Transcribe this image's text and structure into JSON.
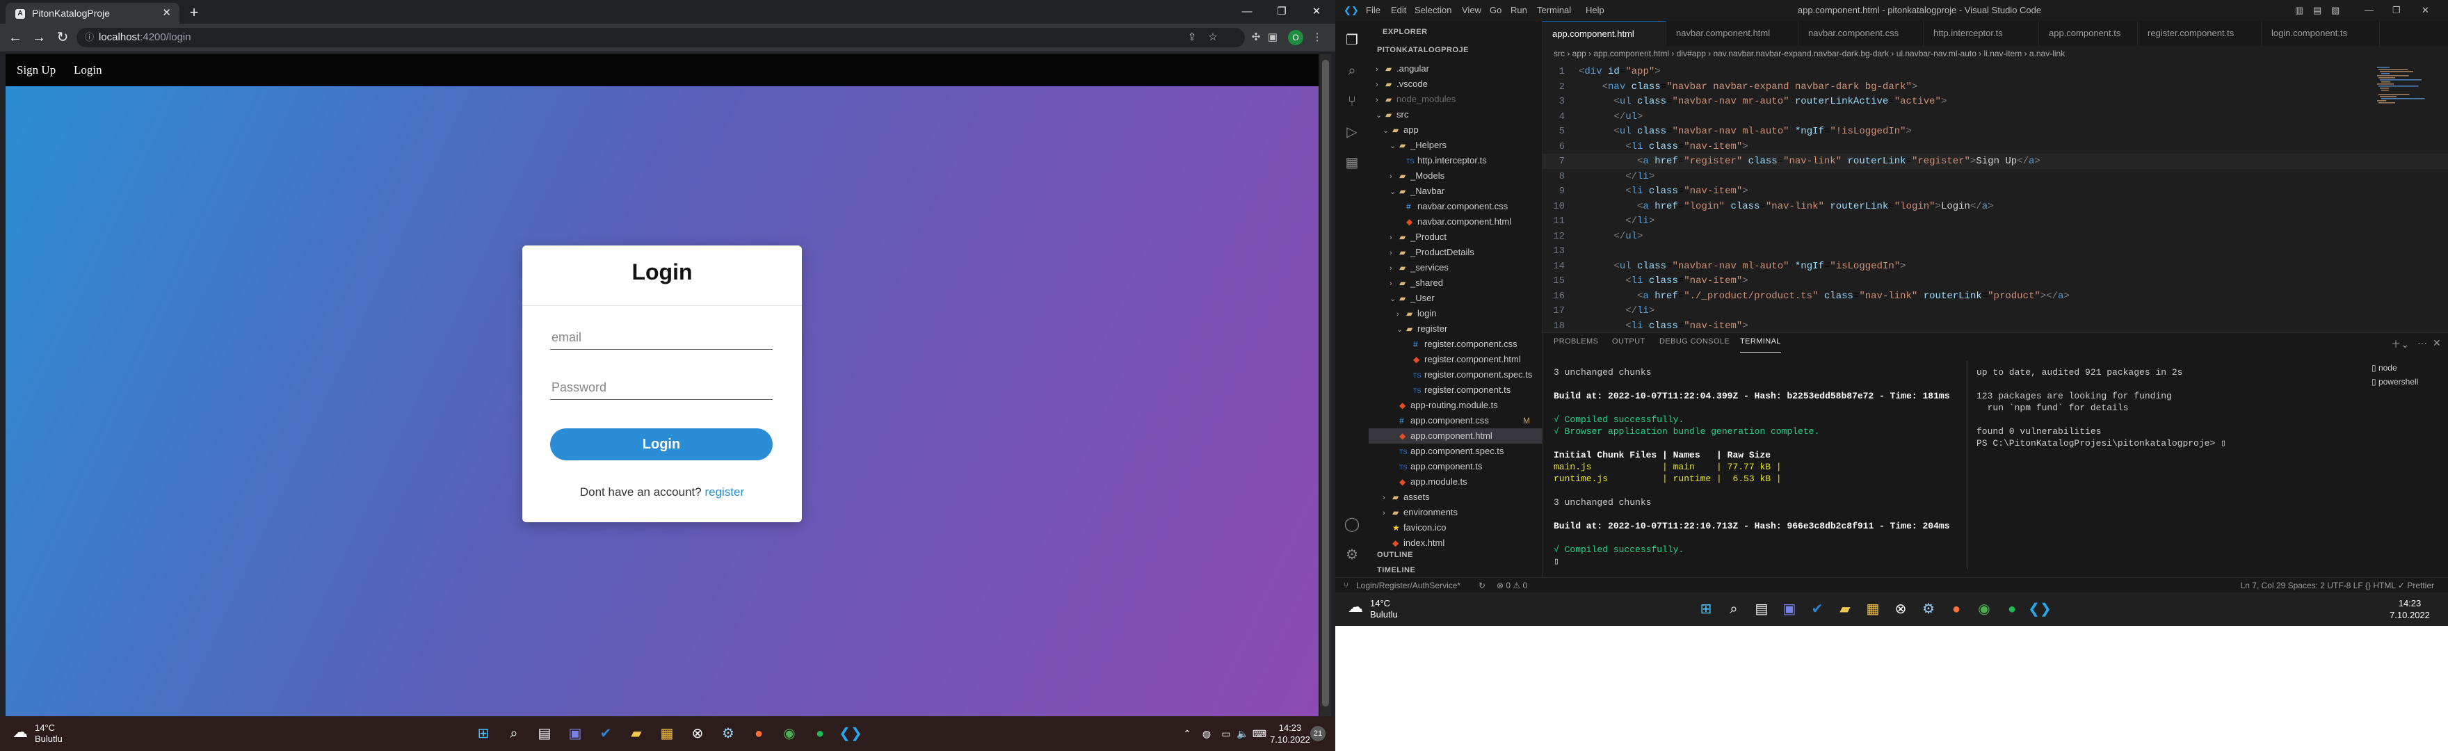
{
  "browser": {
    "tab_title": "PitonKatalogProje",
    "tab_favicon": "A",
    "url_host": "localhost",
    "url_path": ":4200/login",
    "profile_initial": "O"
  },
  "site": {
    "nav_signup": "Sign Up",
    "nav_login": "Login",
    "card": {
      "title": "Login",
      "email_placeholder": "email",
      "password_placeholder": "Password",
      "login_button": "Login",
      "no_account_text": "Dont have an account?",
      "register_link": "register"
    }
  },
  "taskbar_left": {
    "weather_temp": "14°C",
    "weather_desc": "Bulutlu",
    "time": "14:23",
    "date": "7.10.2022",
    "notification_count": "21"
  },
  "vscode": {
    "title": "app.component.html - pitonkatalogproje - Visual Studio Code",
    "menu": [
      "File",
      "Edit",
      "Selection",
      "View",
      "Go",
      "Run",
      "Terminal",
      "Help"
    ],
    "explorer_label": "EXPLORER",
    "project_label": "PITONKATALOGPROJE",
    "tree": [
      {
        "label": ".angular",
        "depth": 1,
        "kind": "folder",
        "chev": "›"
      },
      {
        "label": ".vscode",
        "depth": 1,
        "kind": "folder",
        "chev": "›"
      },
      {
        "label": "node_modules",
        "depth": 1,
        "kind": "folder",
        "chev": "›"
      },
      {
        "label": "src",
        "depth": 1,
        "kind": "folder",
        "chev": "⌄"
      },
      {
        "label": "app",
        "depth": 2,
        "kind": "folder",
        "chev": "⌄"
      },
      {
        "label": "_Helpers",
        "depth": 3,
        "kind": "folder",
        "chev": "⌄"
      },
      {
        "label": "http.interceptor.ts",
        "depth": 4,
        "kind": "ts",
        "chev": ""
      },
      {
        "label": "_Models",
        "depth": 3,
        "kind": "folder",
        "chev": "›"
      },
      {
        "label": "_Navbar",
        "depth": 3,
        "kind": "folder",
        "chev": "⌄"
      },
      {
        "label": "navbar.component.css",
        "depth": 4,
        "kind": "css",
        "chev": ""
      },
      {
        "label": "navbar.component.html",
        "depth": 4,
        "kind": "html",
        "chev": ""
      },
      {
        "label": "_Product",
        "depth": 3,
        "kind": "folder",
        "chev": "›"
      },
      {
        "label": "_ProductDetails",
        "depth": 3,
        "kind": "folder",
        "chev": "›"
      },
      {
        "label": "_services",
        "depth": 3,
        "kind": "folder",
        "chev": "›"
      },
      {
        "label": "_shared",
        "depth": 3,
        "kind": "folder",
        "chev": "›"
      },
      {
        "label": "_User",
        "depth": 3,
        "kind": "folder",
        "chev": "⌄"
      },
      {
        "label": "login",
        "depth": 4,
        "kind": "folder",
        "chev": "›"
      },
      {
        "label": "register",
        "depth": 4,
        "kind": "folder",
        "chev": "⌄"
      },
      {
        "label": "register.component.css",
        "depth": 5,
        "kind": "css",
        "chev": ""
      },
      {
        "label": "register.component.html",
        "depth": 5,
        "kind": "html",
        "chev": ""
      },
      {
        "label": "register.component.spec.ts",
        "depth": 5,
        "kind": "ts",
        "chev": ""
      },
      {
        "label": "register.component.ts",
        "depth": 5,
        "kind": "ts",
        "chev": ""
      },
      {
        "label": "app-routing.module.ts",
        "depth": 3,
        "kind": "html",
        "chev": ""
      },
      {
        "label": "app.component.css",
        "depth": 3,
        "kind": "css",
        "chev": "",
        "badge": "M"
      },
      {
        "label": "app.component.html",
        "depth": 3,
        "kind": "html",
        "chev": "",
        "selected": true
      },
      {
        "label": "app.component.spec.ts",
        "depth": 3,
        "kind": "ts",
        "chev": ""
      },
      {
        "label": "app.component.ts",
        "depth": 3,
        "kind": "ts",
        "chev": ""
      },
      {
        "label": "app.module.ts",
        "depth": 3,
        "kind": "html",
        "chev": ""
      },
      {
        "label": "assets",
        "depth": 2,
        "kind": "folder",
        "chev": "›"
      },
      {
        "label": "environments",
        "depth": 2,
        "kind": "folder",
        "chev": "›"
      },
      {
        "label": "favicon.ico",
        "depth": 2,
        "kind": "star",
        "chev": ""
      },
      {
        "label": "index.html",
        "depth": 2,
        "kind": "html",
        "chev": ""
      }
    ],
    "outline_label": "OUTLINE",
    "timeline_label": "TIMELINE",
    "tabs": [
      "app.component.html",
      "navbar.component.html",
      "navbar.component.css",
      "http.interceptor.ts",
      "app.component.ts",
      "register.component.ts",
      "login.component.ts"
    ],
    "breadcrumb": "src › app › app.component.html › div#app › nav.navbar.navbar-expand.navbar-dark.bg-dark › ul.navbar-nav.ml-auto › li.nav-item › a.nav-link",
    "code_lines": [
      {
        "n": "1",
        "html": "<span class=\"pn\">&lt;</span><span class=\"tg\">div</span> <span class=\"at\">id</span>=<span class=\"sv\">\"app\"</span><span class=\"pn\">&gt;</span>"
      },
      {
        "n": "2",
        "html": "    <span class=\"pn\">&lt;</span><span class=\"tg\">nav</span> <span class=\"at\">class</span>=<span class=\"sv\">\"navbar navbar-expand navbar-dark bg-dark\"</span><span class=\"pn\">&gt;</span>"
      },
      {
        "n": "3",
        "html": "      <span class=\"pn\">&lt;</span><span class=\"tg\">ul</span> <span class=\"at\">class</span>=<span class=\"sv\">\"navbar-nav mr-auto\"</span> <span class=\"at\">routerLinkActive</span>=<span class=\"sv\">\"active\"</span><span class=\"pn\">&gt;</span>"
      },
      {
        "n": "4",
        "html": "      <span class=\"pn\">&lt;/</span><span class=\"tg\">ul</span><span class=\"pn\">&gt;</span>"
      },
      {
        "n": "5",
        "html": "      <span class=\"pn\">&lt;</span><span class=\"tg\">ul</span> <span class=\"at\">class</span>=<span class=\"sv\">\"navbar-nav ml-auto\"</span> <span class=\"at\">*ngIf</span>=<span class=\"sv\">\"!isLoggedIn\"</span><span class=\"pn\">&gt;</span>"
      },
      {
        "n": "6",
        "html": "        <span class=\"pn\">&lt;</span><span class=\"tg\">li</span> <span class=\"at\">class</span>=<span class=\"sv\">\"nav-item\"</span><span class=\"pn\">&gt;</span>"
      },
      {
        "n": "7",
        "html": "          <span class=\"pn\">&lt;</span><span class=\"tg\">a</span> <span class=\"at\">href</span>=<span class=\"sv\">\"register\"</span> <span class=\"at\">class</span>=<span class=\"sv\">\"nav-link\"</span> <span class=\"at\">routerLink</span>=<span class=\"sv\">\"register\"</span><span class=\"pn\">&gt;</span><span class=\"tx\">Sign Up</span><span class=\"pn\">&lt;/</span><span class=\"tg\">a</span><span class=\"pn\">&gt;</span>",
        "current": true
      },
      {
        "n": "8",
        "html": "        <span class=\"pn\">&lt;/</span><span class=\"tg\">li</span><span class=\"pn\">&gt;</span>"
      },
      {
        "n": "9",
        "html": "        <span class=\"pn\">&lt;</span><span class=\"tg\">li</span> <span class=\"at\">class</span>=<span class=\"sv\">\"nav-item\"</span><span class=\"pn\">&gt;</span>"
      },
      {
        "n": "10",
        "html": "          <span class=\"pn\">&lt;</span><span class=\"tg\">a</span> <span class=\"at\">href</span>=<span class=\"sv\">\"login\"</span> <span class=\"at\">class</span>=<span class=\"sv\">\"nav-link\"</span> <span class=\"at\">routerLink</span>=<span class=\"sv\">\"login\"</span><span class=\"pn\">&gt;</span><span class=\"tx\">Login</span><span class=\"pn\">&lt;/</span><span class=\"tg\">a</span><span class=\"pn\">&gt;</span>"
      },
      {
        "n": "11",
        "html": "        <span class=\"pn\">&lt;/</span><span class=\"tg\">li</span><span class=\"pn\">&gt;</span>"
      },
      {
        "n": "12",
        "html": "      <span class=\"pn\">&lt;/</span><span class=\"tg\">ul</span><span class=\"pn\">&gt;</span>"
      },
      {
        "n": "13",
        "html": ""
      },
      {
        "n": "14",
        "html": "      <span class=\"pn\">&lt;</span><span class=\"tg\">ul</span> <span class=\"at\">class</span>=<span class=\"sv\">\"navbar-nav ml-auto\"</span> <span class=\"at\">*ngIf</span>=<span class=\"sv\">\"isLoggedIn\"</span><span class=\"pn\">&gt;</span>"
      },
      {
        "n": "15",
        "html": "        <span class=\"pn\">&lt;</span><span class=\"tg\">li</span> <span class=\"at\">class</span>=<span class=\"sv\">\"nav-item\"</span><span class=\"pn\">&gt;</span>"
      },
      {
        "n": "16",
        "html": "          <span class=\"pn\">&lt;</span><span class=\"tg\">a</span> <span class=\"at\">href</span>=<span class=\"sv\">\"./_product/product.ts\"</span> <span class=\"at\">class</span>=<span class=\"sv\">\"nav-link\"</span> <span class=\"at\">routerLink</span>=<span class=\"sv\">\"product\"</span><span class=\"pn\">&gt;&lt;/</span><span class=\"tg\">a</span><span class=\"pn\">&gt;</span>"
      },
      {
        "n": "17",
        "html": "        <span class=\"pn\">&lt;/</span><span class=\"tg\">li</span><span class=\"pn\">&gt;</span>"
      },
      {
        "n": "18",
        "html": "        <span class=\"pn\">&lt;</span><span class=\"tg\">li</span> <span class=\"at\">class</span>=<span class=\"sv\">\"nav-item\"</span><span class=\"pn\">&gt;</span>"
      }
    ],
    "panel_tabs": [
      "PROBLEMS",
      "OUTPUT",
      "DEBUG CONSOLE",
      "TERMINAL"
    ],
    "terminal_left": [
      {
        "t": "3 unchanged chunks",
        "c": ""
      },
      {
        "t": "",
        "c": ""
      },
      {
        "t": "Build at: 2022-10-07T11:22:04.399Z - Hash: b2253edd58b87e72 - Time: 181ms",
        "c": "build"
      },
      {
        "t": "",
        "c": ""
      },
      {
        "t": "√ Compiled successfully.",
        "c": "ok"
      },
      {
        "t": "√ Browser application bundle generation complete.",
        "c": "ok"
      },
      {
        "t": "",
        "c": ""
      },
      {
        "t": "Initial Chunk Files | Names   | Raw Size",
        "c": "white"
      },
      {
        "t": "main.js             | main    | 77.77 kB |",
        "c": "file"
      },
      {
        "t": "runtime.js          | runtime |  6.53 kB |",
        "c": "file"
      },
      {
        "t": "",
        "c": ""
      },
      {
        "t": "3 unchanged chunks",
        "c": ""
      },
      {
        "t": "",
        "c": ""
      },
      {
        "t": "Build at: 2022-10-07T11:22:10.713Z - Hash: 966e3c8db2c8f911 - Time: 204ms",
        "c": "build"
      },
      {
        "t": "",
        "c": ""
      },
      {
        "t": "√ Compiled successfully.",
        "c": "ok"
      },
      {
        "t": "▯",
        "c": ""
      }
    ],
    "terminal_right": [
      "up to date, audited 921 packages in 2s",
      "",
      "123 packages are looking for funding",
      "  run `npm fund` for details",
      "",
      "found 0 vulnerabilities",
      "PS C:\\PitonKatalogProjesi\\pitonkatalogproje> ▯"
    ],
    "terminal_list": [
      "node",
      "powershell"
    ],
    "status_left": "Login/Register/AuthService*",
    "status_right": "Ln 7, Col 29   Spaces: 2   UTF-8   LF   {} HTML   ✓ Prettier"
  },
  "taskbar_right": {
    "weather_temp": "14°C",
    "weather_desc": "Bulutlu",
    "time": "14:23",
    "date": "7.10.2022"
  }
}
